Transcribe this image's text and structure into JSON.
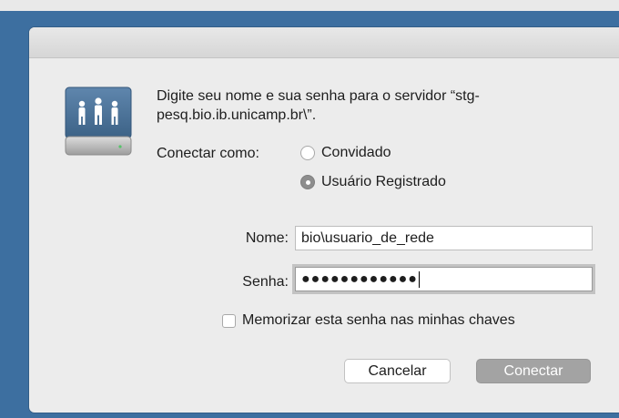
{
  "dialog": {
    "message": "Digite seu nome e sua senha para o servidor “stg-pesq.bio.ib.unicamp.br\\”.",
    "icon": "network-server-icon",
    "connect_as_label": "Conectar como:",
    "options": {
      "guest": "Convidado",
      "registered": "Usuário Registrado"
    },
    "selected_option": "Usuário Registrado",
    "name_label": "Nome:",
    "name_value": "bio\\usuario_de_rede",
    "password_label": "Senha:",
    "password_masked": "●●●●●●●●●●●●",
    "remember_label": "Memorizar esta senha nas minhas chaves",
    "remember_checked": false,
    "cancel_label": "Cancelar",
    "connect_label": "Conectar"
  },
  "colors": {
    "background": "#3d6fa0",
    "dialog": "#ececec",
    "primary_button": "#a3a3a3"
  }
}
